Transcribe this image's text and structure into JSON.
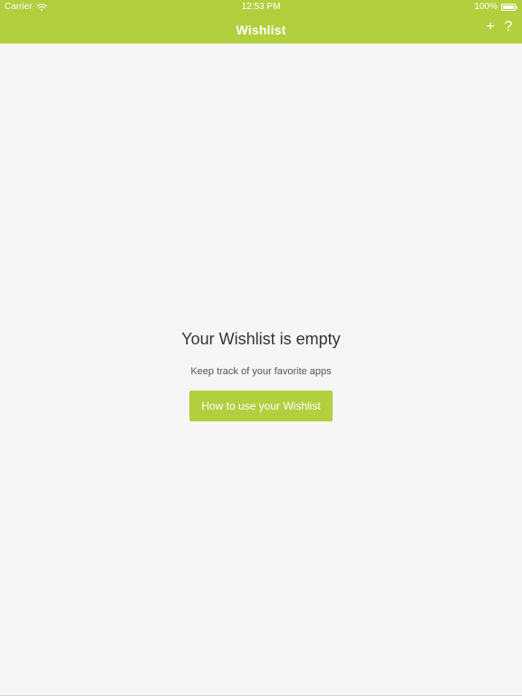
{
  "status": {
    "carrier": "Carrier",
    "time": "12:53 PM",
    "battery": "100%"
  },
  "nav": {
    "title": "Wishlist",
    "add_icon": "+",
    "help_icon": "?"
  },
  "empty": {
    "title": "Your Wishlist is empty",
    "subtitle": "Keep track of your favorite apps",
    "button": "How to use your Wishlist"
  },
  "colors": {
    "accent": "#b2cf3e",
    "background": "#f6f6f6",
    "text": "#333333"
  }
}
